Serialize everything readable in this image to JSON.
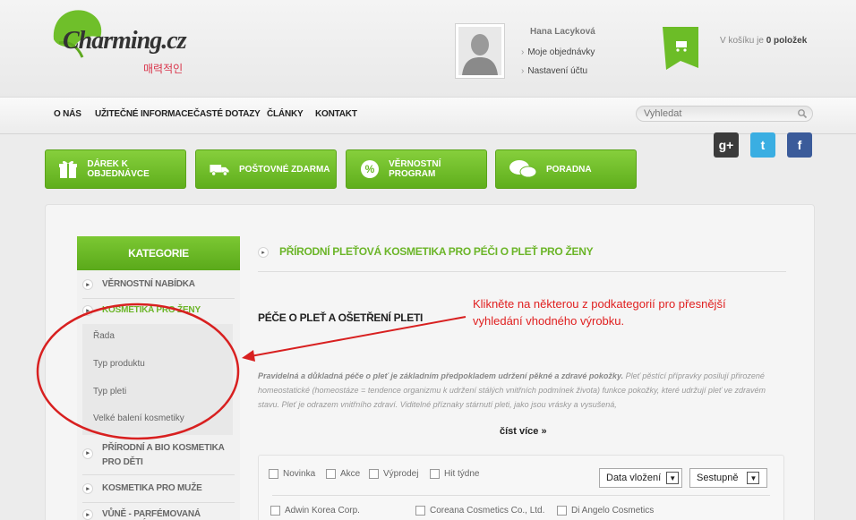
{
  "logo": {
    "text_main": "Charming.cz",
    "text_korean": "매력적인"
  },
  "user": {
    "name": "Hana Lacyková",
    "links": [
      "Moje objednávky",
      "Nastavení účtu"
    ]
  },
  "cart": {
    "prefix": "V košíku je",
    "count_label": "0 položek"
  },
  "nav": {
    "items": [
      "O NÁS",
      "UŽITEČNÉ INFORMACE",
      "ČASTÉ DOTAZY",
      "ČLÁNKY",
      "KONTAKT"
    ]
  },
  "search": {
    "placeholder": "Vyhledat"
  },
  "social": {
    "items": [
      "g+",
      "t",
      "f"
    ]
  },
  "promo": {
    "items": [
      "DÁREK K OBJEDNÁVCE",
      "POŠTOVNÉ ZDARMA",
      "VĚRNOSTNÍ PROGRAM",
      "PORADNA"
    ]
  },
  "sidebar": {
    "title": "KATEGORIE",
    "items": [
      "VĚRNOSTNÍ NABÍDKA",
      "KOSMETIKA PRO ŽENY",
      "PŘÍRODNÍ A BIO KOSMETIKA PRO DĚTI",
      "KOSMETIKA PRO MUŽE",
      "VŮNĚ - PARFÉMOVANÁ TOALETNÍ"
    ],
    "subitems": [
      "Řada",
      "Typ produktu",
      "Typ pleti",
      "Velké balení kosmetiky"
    ]
  },
  "main": {
    "title": "PŘÍRODNÍ PLEŤOVÁ KOSMETIKA PRO PÉČI O PLEŤ PRO ŽENY",
    "subtitle": "PÉČE O PLEŤ A OŠETŘENÍ PLETI",
    "desc_bold": "Pravidelná a důkladná péče o pleť je základním předpokladem udržení pěkné a zdravé pokožky.",
    "desc_rest": " Pleť pěstící přípravky posilují přirozené homeostatické (homeostáze = tendence organizmu k udržení stálých vnitřních podmínek života) funkce pokožky, které udržují pleť ve zdravém stavu. Pleť je odrazem vnitřního zdraví. Viditelné příznaky stárnutí pleti, jako jsou vrásky a vysušená,",
    "read_more": "číst více »"
  },
  "annotation": {
    "text": "Klikněte na některou z podkategorií pro přesnější vyhledání vhodného výrobku."
  },
  "filters": {
    "checkboxes": [
      "Novinka",
      "Akce",
      "Výprodej",
      "Hit týdne"
    ],
    "sort_field": "Data vložení",
    "sort_order": "Sestupně",
    "brands": [
      "Adwin Korea Corp.",
      "Coreana Cosmetics Co., Ltd.",
      "Di Angelo Cosmetics"
    ]
  },
  "colors": {
    "brand_green": "#6bb528",
    "annotation_red": "#e02020"
  }
}
